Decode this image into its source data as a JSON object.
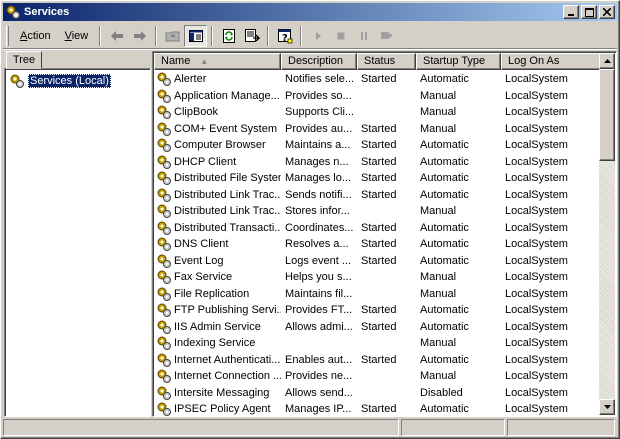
{
  "window": {
    "title": "Services"
  },
  "menu": {
    "action": "Action",
    "action_accel": "A",
    "action_rest": "ction",
    "view": "View",
    "view_accel": "V",
    "view_rest": "iew"
  },
  "tree": {
    "tab_label": "Tree",
    "root_label": "Services (Local)"
  },
  "columns": {
    "name": "Name",
    "description": "Description",
    "status": "Status",
    "startup": "Startup Type",
    "logon": "Log On As"
  },
  "services": [
    {
      "name": "Alerter",
      "description": "Notifies sele...",
      "status": "Started",
      "startup": "Automatic",
      "logon": "LocalSystem"
    },
    {
      "name": "Application Manage...",
      "description": "Provides so...",
      "status": "",
      "startup": "Manual",
      "logon": "LocalSystem"
    },
    {
      "name": "ClipBook",
      "description": "Supports Cli...",
      "status": "",
      "startup": "Manual",
      "logon": "LocalSystem"
    },
    {
      "name": "COM+ Event System",
      "description": "Provides au...",
      "status": "Started",
      "startup": "Manual",
      "logon": "LocalSystem"
    },
    {
      "name": "Computer Browser",
      "description": "Maintains a...",
      "status": "Started",
      "startup": "Automatic",
      "logon": "LocalSystem"
    },
    {
      "name": "DHCP Client",
      "description": "Manages n...",
      "status": "Started",
      "startup": "Automatic",
      "logon": "LocalSystem"
    },
    {
      "name": "Distributed File System",
      "description": "Manages lo...",
      "status": "Started",
      "startup": "Automatic",
      "logon": "LocalSystem"
    },
    {
      "name": "Distributed Link Trac...",
      "description": "Sends notifi...",
      "status": "Started",
      "startup": "Automatic",
      "logon": "LocalSystem"
    },
    {
      "name": "Distributed Link Trac...",
      "description": "Stores infor...",
      "status": "",
      "startup": "Manual",
      "logon": "LocalSystem"
    },
    {
      "name": "Distributed Transacti...",
      "description": "Coordinates...",
      "status": "Started",
      "startup": "Automatic",
      "logon": "LocalSystem"
    },
    {
      "name": "DNS Client",
      "description": "Resolves a...",
      "status": "Started",
      "startup": "Automatic",
      "logon": "LocalSystem"
    },
    {
      "name": "Event Log",
      "description": "Logs event ...",
      "status": "Started",
      "startup": "Automatic",
      "logon": "LocalSystem"
    },
    {
      "name": "Fax Service",
      "description": "Helps you s...",
      "status": "",
      "startup": "Manual",
      "logon": "LocalSystem"
    },
    {
      "name": "File Replication",
      "description": "Maintains fil...",
      "status": "",
      "startup": "Manual",
      "logon": "LocalSystem"
    },
    {
      "name": "FTP Publishing Servi...",
      "description": "Provides FT...",
      "status": "Started",
      "startup": "Automatic",
      "logon": "LocalSystem"
    },
    {
      "name": "IIS Admin Service",
      "description": "Allows admi...",
      "status": "Started",
      "startup": "Automatic",
      "logon": "LocalSystem"
    },
    {
      "name": "Indexing Service",
      "description": "",
      "status": "",
      "startup": "Manual",
      "logon": "LocalSystem"
    },
    {
      "name": "Internet Authenticati...",
      "description": "Enables aut...",
      "status": "Started",
      "startup": "Automatic",
      "logon": "LocalSystem"
    },
    {
      "name": "Internet Connection ...",
      "description": "Provides ne...",
      "status": "",
      "startup": "Manual",
      "logon": "LocalSystem"
    },
    {
      "name": "Intersite Messaging",
      "description": "Allows send...",
      "status": "",
      "startup": "Disabled",
      "logon": "LocalSystem"
    },
    {
      "name": "IPSEC Policy Agent",
      "description": "Manages IP...",
      "status": "Started",
      "startup": "Automatic",
      "logon": "LocalSystem"
    }
  ],
  "icons": {
    "title": "services-gear-icon",
    "back": "back-arrow-icon",
    "forward": "forward-arrow-icon",
    "up": "up-folder-icon",
    "show_tree": "show-hide-tree-icon",
    "refresh": "refresh-icon",
    "export": "export-list-icon",
    "help": "help-icon",
    "start": "start-service-icon",
    "stop": "stop-service-icon",
    "pause": "pause-service-icon",
    "restart": "restart-service-icon"
  },
  "colors": {
    "title_start": "#0a246a",
    "title_end": "#a6caf0",
    "face": "#d4d0c8",
    "selection": "#0a246a"
  }
}
